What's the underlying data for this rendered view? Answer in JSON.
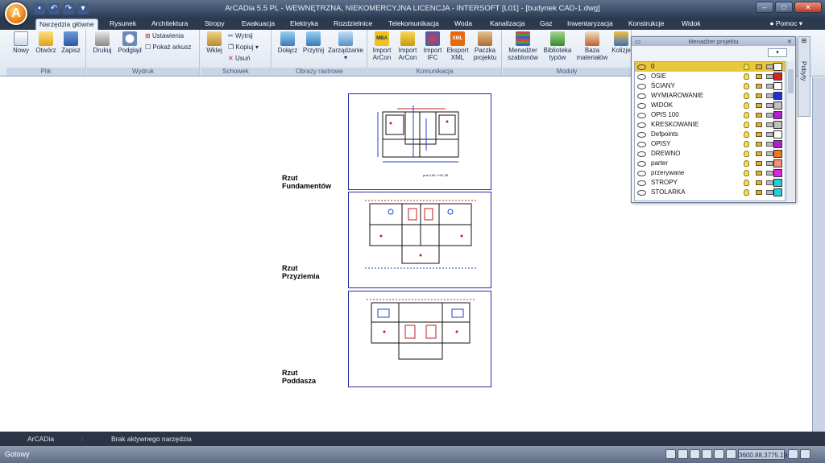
{
  "window": {
    "title": "ArCADia 5.5 PL - WEWNĘTRZNA, NIEKOMERCYJNA LICENCJA - INTERSOFT [L01] - [budynek CAD-1.dwg]",
    "logo_letter": "A"
  },
  "tabs": [
    "Narzędzia główne",
    "Rysunek",
    "Architektura",
    "Stropy",
    "Ewakuacja",
    "Elektryka",
    "Rozdzielnice",
    "Telekomunikacja",
    "Woda",
    "Kanalizacja",
    "Gaz",
    "Inwentaryzacja",
    "Konstrukcje",
    "Widok"
  ],
  "help": "Pomoc",
  "ribbon": {
    "plik": {
      "label": "Plik",
      "nowy": "Nowy",
      "otworz": "Otwórz",
      "zapisz": "Zapisz"
    },
    "wydruk": {
      "label": "Wydruk",
      "drukuj": "Drukuj",
      "podglad": "Podgląd",
      "ustawienia": "Ustawienia",
      "pokaz": "Pokaż arkusz"
    },
    "schowek": {
      "label": "Schowek",
      "wklej": "Wklej",
      "wytnij": "Wytnij",
      "kopiuj": "Kopiuj",
      "usun": "Usuń"
    },
    "obrazy": {
      "label": "Obrazy rastrowe",
      "dolacz": "Dołącz",
      "przytnij": "Przytnij",
      "zarzadzanie": "Zarządzanie"
    },
    "komunikacja": {
      "label": "Komunikacja",
      "import_arcon1": "Import\nArCon",
      "import_arcon2": "Import\nArCon",
      "import_ifc": "Import\nIFC",
      "eksport_xml": "Eksport\nXML",
      "paczka": "Paczka\nprojektu"
    },
    "moduly": {
      "label": "Moduły",
      "menadzer": "Menadżer\nszablonów",
      "biblioteka": "Biblioteka\ntypów",
      "baza": "Baza\nmateriałów",
      "kolizje": "Kolizje"
    }
  },
  "plans": [
    {
      "label": "Rzut\nFundamentów",
      "note": "poz.0,00 =+91,35"
    },
    {
      "label": "Rzut\nPrzyziemia"
    },
    {
      "label": "Rzut\nPoddasza"
    }
  ],
  "project_manager": {
    "title": "Menadżer projektu",
    "side_tab": "Pobyty",
    "layers": [
      {
        "name": "0",
        "color": "#ffffff",
        "selected": true
      },
      {
        "name": "OSIE",
        "color": "#e0201c"
      },
      {
        "name": "ŚCIANY",
        "color": "#ffffff"
      },
      {
        "name": "WYMIAROWANIE",
        "color": "#1f2fd8"
      },
      {
        "name": "WIDOK",
        "color": "#c0c0c0"
      },
      {
        "name": "OPIS 100",
        "color": "#b020d0"
      },
      {
        "name": "KRESKOWANIE",
        "color": "#c0c0c0"
      },
      {
        "name": "Defpoints",
        "color": "#ffffff"
      },
      {
        "name": "OPISY",
        "color": "#b020d0"
      },
      {
        "name": "DREWNO",
        "color": "#f07a18"
      },
      {
        "name": "parter",
        "color": "#f09080"
      },
      {
        "name": "przerywane",
        "color": "#e020e0"
      },
      {
        "name": "STROPY",
        "color": "#20d0e0"
      },
      {
        "name": "STOLARKA",
        "color": "#20d0e0"
      }
    ]
  },
  "command": {
    "app": "ArCADia",
    "status": "Brak aktywnego narzędzia"
  },
  "status": {
    "text": "Gotowy",
    "coords": "3600.88,3775.19"
  }
}
